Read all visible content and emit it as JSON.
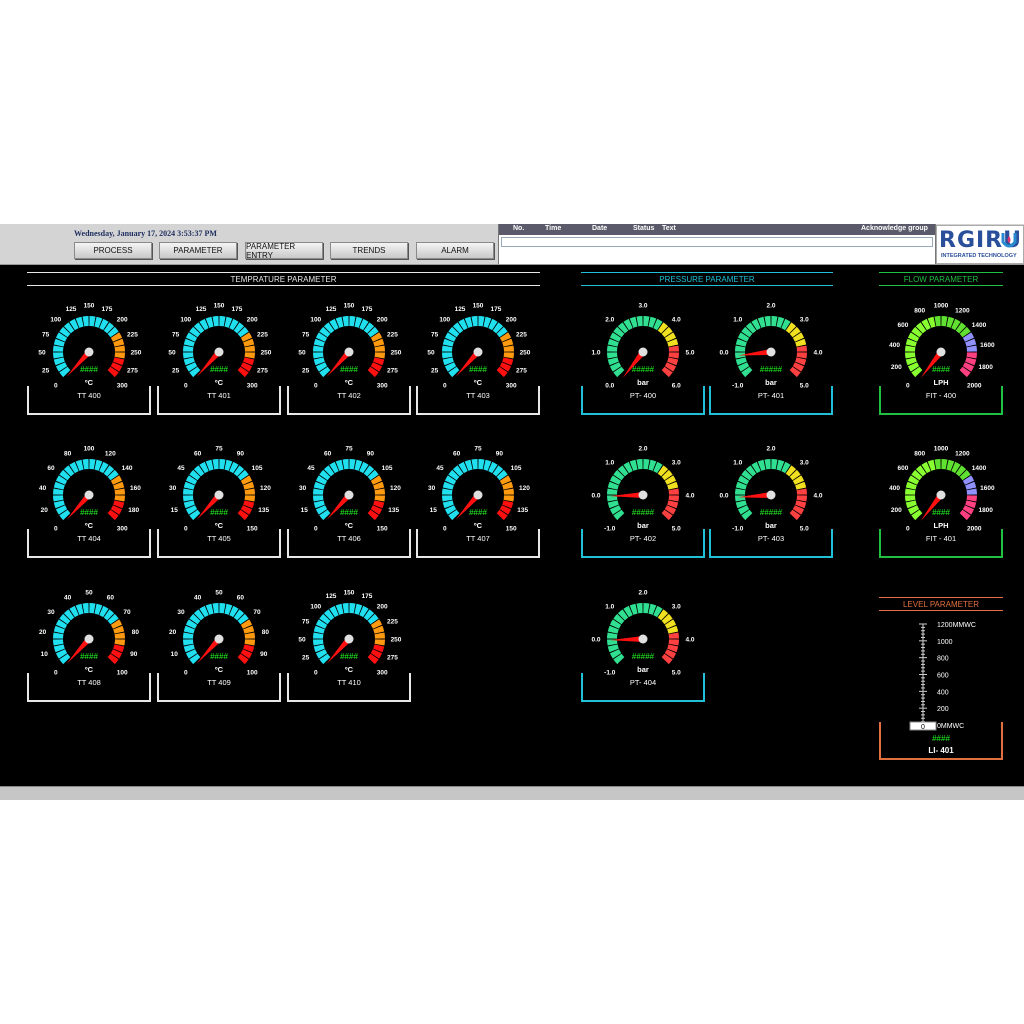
{
  "header": {
    "datetime": "Wednesday, January 17, 2024 3:53:37 PM",
    "nav": [
      {
        "label": "PROCESS"
      },
      {
        "label": "PARAMETER"
      },
      {
        "label": "PARAMETER ENTRY"
      },
      {
        "label": "TRENDS"
      },
      {
        "label": "ALARM"
      }
    ]
  },
  "alarm": {
    "columns": [
      "No.",
      "Time",
      "Date",
      "Status",
      "Text"
    ],
    "ack_label": "Acknowledge group"
  },
  "logo": {
    "word": "RGIRU",
    "tagline": "INTEGRATED TECHNOLOGY"
  },
  "sections": {
    "temperature": "TEMPRATURE PARAMETER",
    "pressure": "PRESSURE PARAMETER",
    "flow": "FLOW PARAMETER",
    "level": "LEVEL PARAMETER"
  },
  "colors": {
    "temperature": "#e8e8e8",
    "pressure": "#20c0d8",
    "flow": "#20c040",
    "level": "#e07040",
    "needle": "#ff1010",
    "readout": "#20ff20"
  },
  "temperature_gauges": [
    {
      "tag": "TT 400",
      "unit": "ºC",
      "value": "####",
      "scale": [
        "0",
        "25",
        "50",
        "75",
        "100",
        "125",
        "150",
        "175",
        "200",
        "225",
        "250",
        "275",
        "300"
      ]
    },
    {
      "tag": "TT 401",
      "unit": "ºC",
      "value": "####",
      "scale": [
        "0",
        "25",
        "50",
        "75",
        "100",
        "125",
        "150",
        "175",
        "200",
        "225",
        "250",
        "275",
        "300"
      ]
    },
    {
      "tag": "TT 402",
      "unit": "ºC",
      "value": "####",
      "scale": [
        "0",
        "25",
        "50",
        "75",
        "100",
        "125",
        "150",
        "175",
        "200",
        "225",
        "250",
        "275",
        "300"
      ]
    },
    {
      "tag": "TT 403",
      "unit": "ºC",
      "value": "####",
      "scale": [
        "0",
        "25",
        "50",
        "75",
        "100",
        "125",
        "150",
        "175",
        "200",
        "225",
        "250",
        "275",
        "300"
      ]
    },
    {
      "tag": "TT 404",
      "unit": "ºC",
      "value": "####",
      "scale": [
        "0",
        "20",
        "40",
        "60",
        "80",
        "100",
        "120",
        "140",
        "160",
        "180",
        "300"
      ]
    },
    {
      "tag": "TT 405",
      "unit": "ºC",
      "value": "####",
      "scale": [
        "0",
        "15",
        "30",
        "45",
        "60",
        "75",
        "90",
        "105",
        "120",
        "135",
        "150"
      ]
    },
    {
      "tag": "TT 406",
      "unit": "ºC",
      "value": "####",
      "scale": [
        "0",
        "15",
        "30",
        "45",
        "60",
        "75",
        "90",
        "105",
        "120",
        "135",
        "150"
      ]
    },
    {
      "tag": "TT 407",
      "unit": "ºC",
      "value": "####",
      "scale": [
        "0",
        "15",
        "30",
        "45",
        "60",
        "75",
        "90",
        "105",
        "120",
        "135",
        "150"
      ]
    },
    {
      "tag": "TT 408",
      "unit": "ºC",
      "value": "####",
      "scale": [
        "0",
        "10",
        "20",
        "30",
        "40",
        "50",
        "60",
        "70",
        "80",
        "90",
        "100"
      ]
    },
    {
      "tag": "TT 409",
      "unit": "ºC",
      "value": "####",
      "scale": [
        "0",
        "10",
        "20",
        "30",
        "40",
        "50",
        "60",
        "70",
        "80",
        "90",
        "100"
      ]
    },
    {
      "tag": "TT 410",
      "unit": "ºC",
      "value": "####",
      "scale": [
        "0",
        "25",
        "50",
        "75",
        "100",
        "125",
        "150",
        "175",
        "200",
        "225",
        "250",
        "275",
        "300"
      ]
    }
  ],
  "pressure_gauges": [
    {
      "tag": "PT- 400",
      "unit": "bar",
      "value": "#####",
      "scale": [
        "0.0",
        "1.0",
        "2.0",
        "3.0",
        "4.0",
        "5.0",
        "6.0"
      ]
    },
    {
      "tag": "PT- 401",
      "unit": "bar",
      "value": "#####",
      "scale": [
        "-1.0",
        "0.0",
        "1.0",
        "2.0",
        "3.0",
        "4.0",
        "5.0"
      ]
    },
    {
      "tag": "PT- 402",
      "unit": "bar",
      "value": "#####",
      "scale": [
        "-1.0",
        "0.0",
        "1.0",
        "2.0",
        "3.0",
        "4.0",
        "5.0"
      ]
    },
    {
      "tag": "PT- 403",
      "unit": "bar",
      "value": "#####",
      "scale": [
        "-1.0",
        "0.0",
        "1.0",
        "2.0",
        "3.0",
        "4.0",
        "5.0"
      ]
    },
    {
      "tag": "PT- 404",
      "unit": "bar",
      "value": "#####",
      "scale": [
        "-1.0",
        "0.0",
        "1.0",
        "2.0",
        "3.0",
        "4.0",
        "5.0"
      ]
    }
  ],
  "flow_gauges": [
    {
      "tag": "FIT - 400",
      "unit": "LPH",
      "value": "####",
      "scale": [
        "0",
        "200",
        "400",
        "600",
        "800",
        "1000",
        "1200",
        "1400",
        "1600",
        "1800",
        "2000"
      ]
    },
    {
      "tag": "FIT - 401",
      "unit": "LPH",
      "value": "####",
      "scale": [
        "0",
        "200",
        "400",
        "600",
        "800",
        "1000",
        "1200",
        "1400",
        "1600",
        "1800",
        "2000"
      ]
    }
  ],
  "level": {
    "tag": "LI- 401",
    "value": "####",
    "bar_value": "0",
    "scale": [
      "0MMWC",
      "200",
      "400",
      "600",
      "800",
      "1000",
      "1200MMWC"
    ]
  }
}
